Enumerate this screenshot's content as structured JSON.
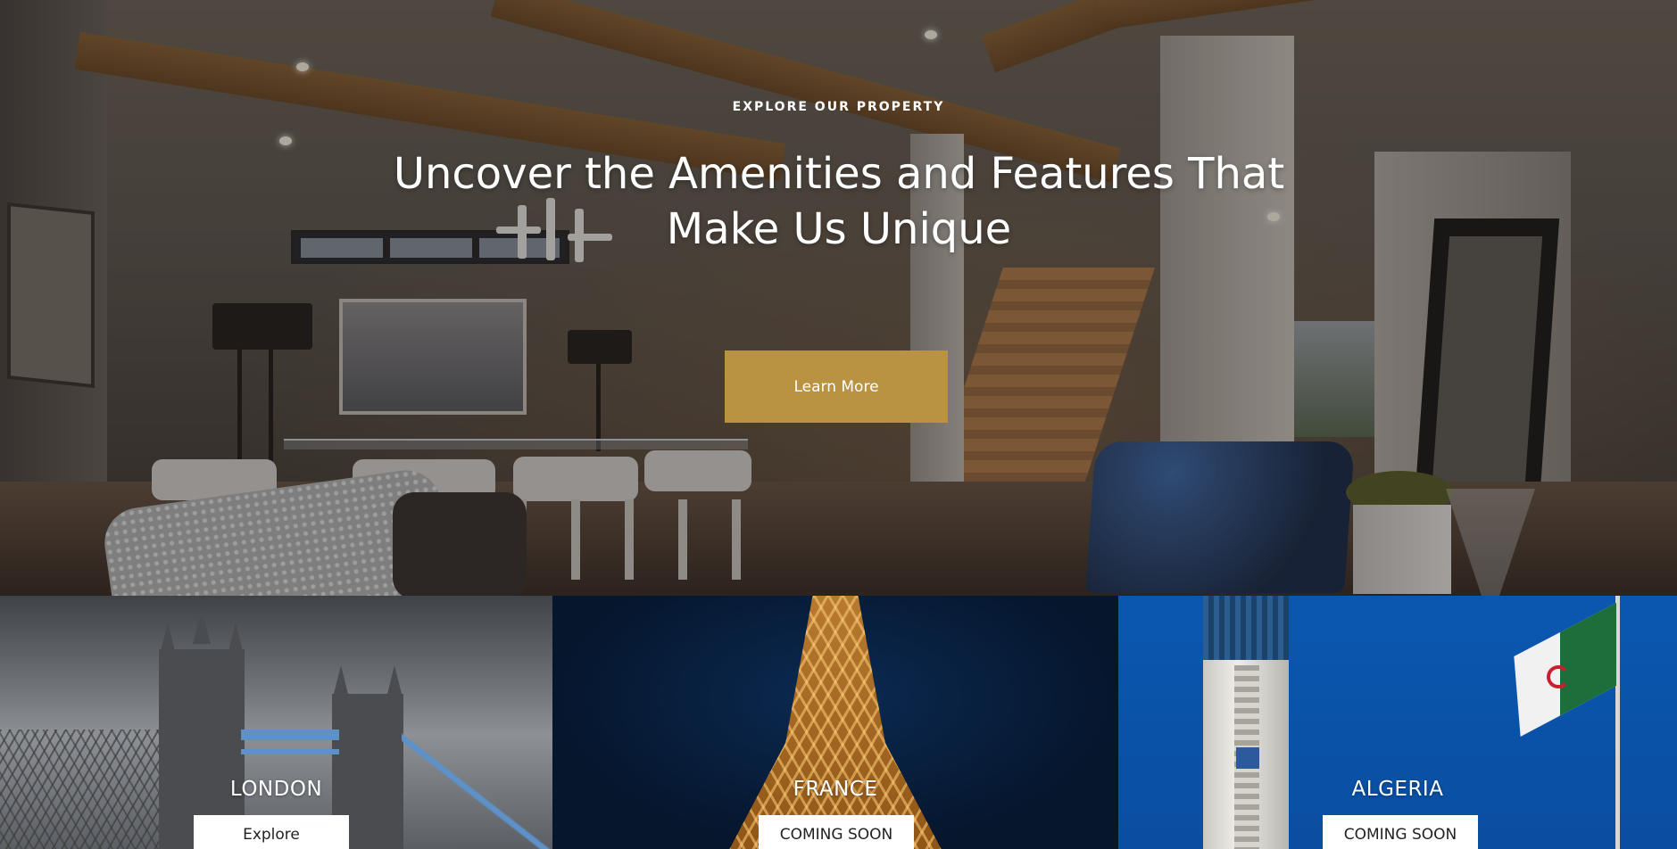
{
  "hero": {
    "eyebrow": "EXPLORE OUR PROPERTY",
    "headline": "Uncover the Amenities and Features That Make Us Unique",
    "cta_label": "Learn More",
    "accent_color": "#b99341"
  },
  "cards": [
    {
      "title": "LONDON",
      "button_label": "Explore"
    },
    {
      "title": "FRANCE",
      "button_label": "COMING SOON"
    },
    {
      "title": "ALGERIA",
      "button_label": "COMING SOON"
    }
  ]
}
